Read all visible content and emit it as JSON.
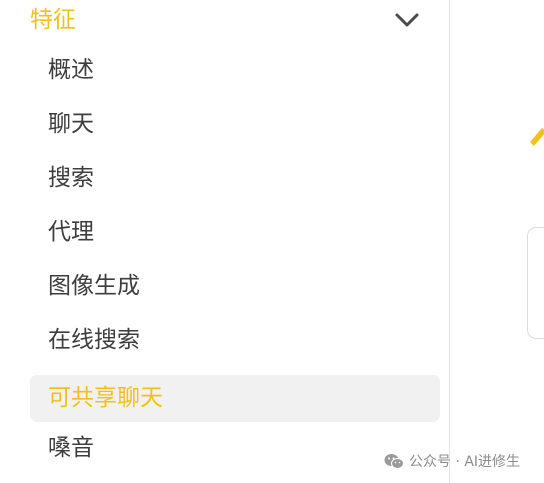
{
  "sidebar": {
    "section_title": "特征",
    "section_expanded": true,
    "items": [
      {
        "label": "概述",
        "active": false
      },
      {
        "label": "聊天",
        "active": false
      },
      {
        "label": "搜索",
        "active": false
      },
      {
        "label": "代理",
        "active": false
      },
      {
        "label": "图像生成",
        "active": false
      },
      {
        "label": "在线搜索",
        "active": false
      },
      {
        "label": "可共享聊天",
        "active": true
      },
      {
        "label": "嗓音",
        "active": false
      }
    ]
  },
  "watermark": {
    "icon": "wechat-icon",
    "text": "公众号 · AI进修生"
  },
  "colors": {
    "accent": "#f2c01c",
    "text": "#3d3d3d",
    "active_bg": "#f1f1f1",
    "divider": "#e6e6e6"
  }
}
